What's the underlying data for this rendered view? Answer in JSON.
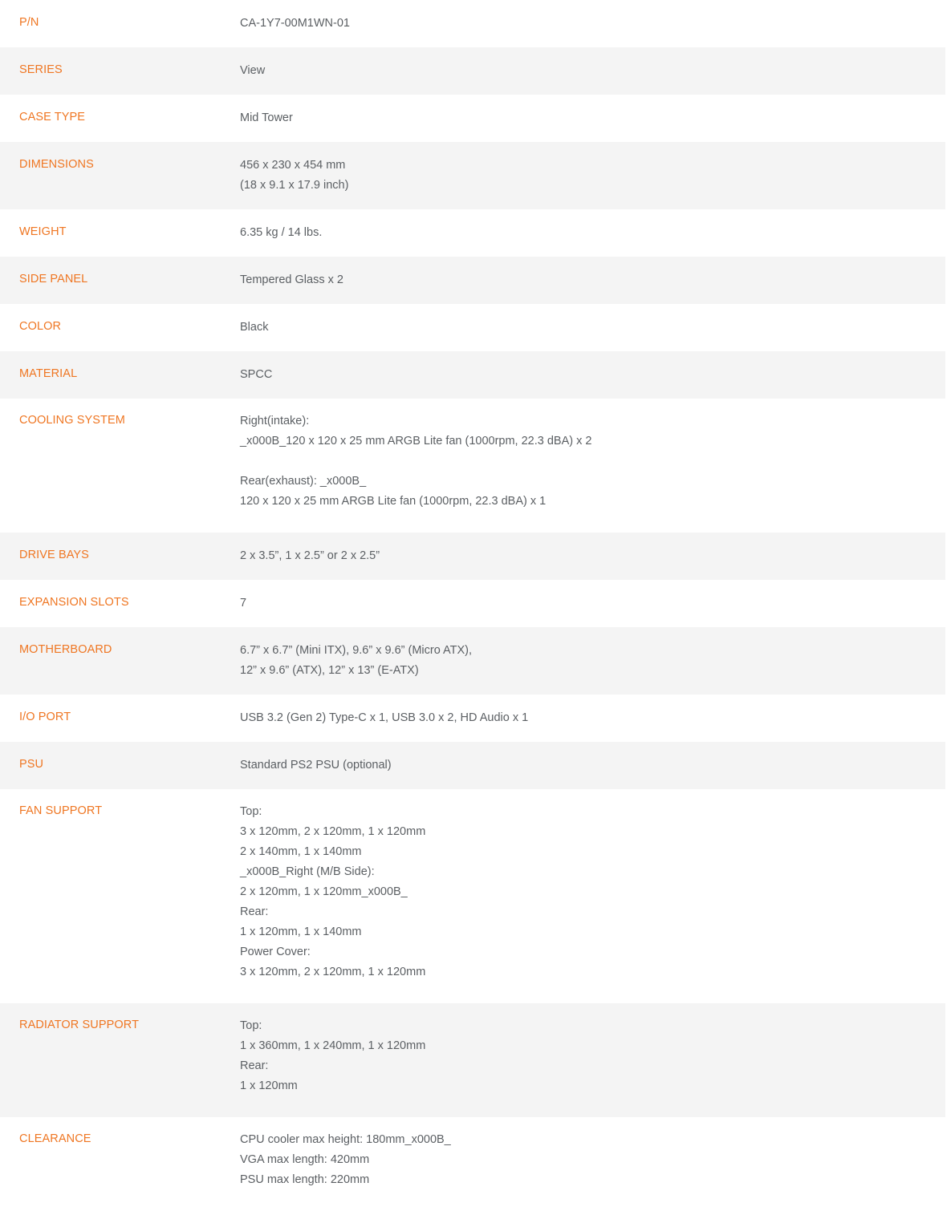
{
  "table": {
    "rows": [
      {
        "label": "P/N",
        "lines": [
          "CA-1Y7-00M1WN-01"
        ]
      },
      {
        "label": "SERIES",
        "lines": [
          "View"
        ]
      },
      {
        "label": "CASE TYPE",
        "lines": [
          "Mid Tower"
        ]
      },
      {
        "label": "DIMENSIONS",
        "lines": [
          "456 x 230 x 454 mm",
          "(18 x 9.1 x 17.9 inch)"
        ]
      },
      {
        "label": "WEIGHT",
        "lines": [
          "6.35 kg / 14 lbs."
        ]
      },
      {
        "label": "SIDE PANEL",
        "lines": [
          "Tempered Glass x 2"
        ]
      },
      {
        "label": "COLOR",
        "lines": [
          "Black"
        ]
      },
      {
        "label": "MATERIAL",
        "lines": [
          "SPCC"
        ]
      },
      {
        "label": "COOLING SYSTEM",
        "lines": [
          "Right(intake):",
          "_x000B_120 x 120 x 25 mm ARGB Lite fan (1000rpm, 22.3 dBA) x 2",
          "",
          "Rear(exhaust): _x000B_",
          "120 x 120 x 25 mm ARGB Lite fan (1000rpm, 22.3 dBA) x 1"
        ]
      },
      {
        "label": "DRIVE BAYS",
        "lines": [
          "2 x 3.5”, 1 x 2.5” or 2 x 2.5”"
        ]
      },
      {
        "label": "EXPANSION SLOTS",
        "lines": [
          "7"
        ]
      },
      {
        "label": "MOTHERBOARD",
        "lines": [
          "6.7” x 6.7” (Mini ITX), 9.6” x 9.6” (Micro ATX),",
          "12” x 9.6” (ATX), 12” x 13” (E-ATX)"
        ]
      },
      {
        "label": "I/O PORT",
        "lines": [
          "USB 3.2 (Gen 2) Type-C x 1, USB 3.0 x 2, HD Audio x 1"
        ]
      },
      {
        "label": "PSU",
        "lines": [
          "Standard PS2 PSU (optional)"
        ]
      },
      {
        "label": "FAN SUPPORT",
        "lines": [
          "Top:",
          "3 x 120mm, 2 x 120mm, 1 x 120mm",
          "2 x 140mm, 1 x 140mm",
          "_x000B_Right (M/B Side):",
          "2 x 120mm, 1 x 120mm_x000B_",
          "Rear:",
          "1 x 120mm, 1 x 140mm",
          "Power Cover:",
          "3 x 120mm, 2 x 120mm, 1 x 120mm"
        ]
      },
      {
        "label": "RADIATOR SUPPORT",
        "lines": [
          "Top:",
          "1 x 360mm, 1 x 240mm, 1 x 120mm",
          "Rear:",
          "1 x 120mm"
        ]
      },
      {
        "label": "CLEARANCE",
        "lines": [
          "CPU cooler max height: 180mm_x000B_",
          "VGA max length: 420mm",
          "PSU max length: 220mm"
        ]
      }
    ]
  },
  "colors": {
    "label": "#ef7622",
    "value": "#5b5f63",
    "stripe": "#f4f4f4",
    "base": "#ffffff"
  }
}
